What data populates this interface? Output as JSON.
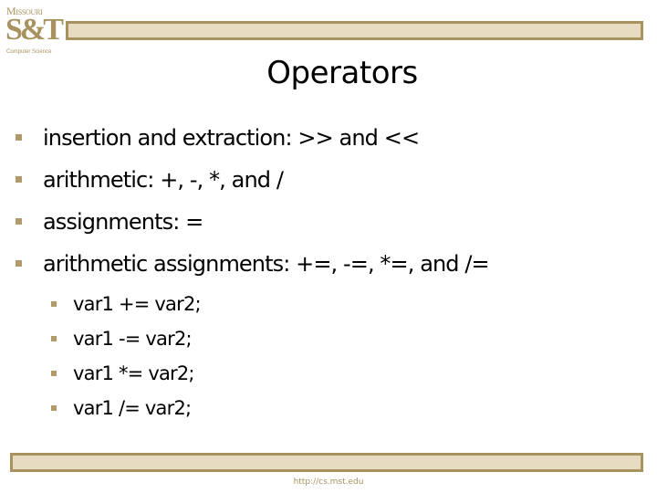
{
  "logo": {
    "name": "Missouri S&T Computer Science logo",
    "top_text": "Missouri",
    "monogram": "S&T",
    "department": "Computer Science"
  },
  "colors": {
    "accent_gold": "#a8925f",
    "bar_fill": "#e7dbc2",
    "text": "#000000"
  },
  "slide": {
    "title": "Operators",
    "bullets": [
      {
        "text": "insertion and extraction: >> and <<"
      },
      {
        "text": "arithmetic: +, -, *, and /"
      },
      {
        "text": "assignments: ="
      },
      {
        "text": "arithmetic assignments: +=, -=, *=, and /=",
        "sub_bullets": [
          {
            "text": "var1 += var2;"
          },
          {
            "text": "var1 -= var2;"
          },
          {
            "text": "var1 *= var2;"
          },
          {
            "text": "var1 /= var2;"
          }
        ]
      }
    ]
  },
  "footer": {
    "url": "http://cs.mst.edu"
  }
}
